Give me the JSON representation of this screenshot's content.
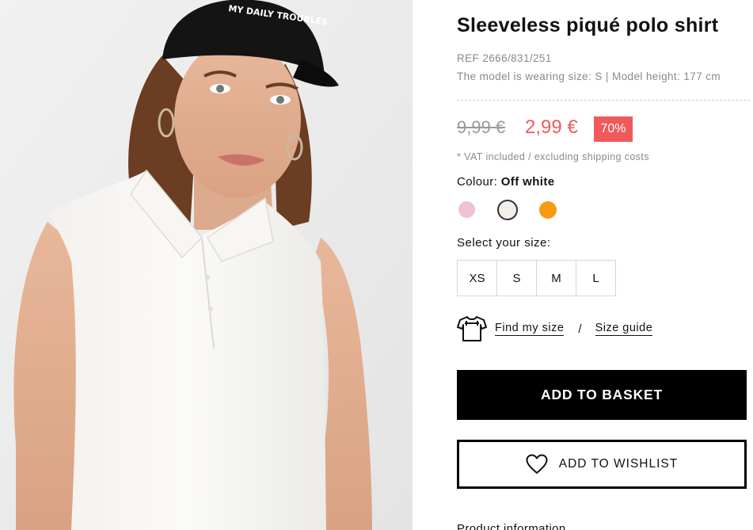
{
  "product": {
    "title": "Sleeveless piqué polo shirt",
    "ref": "REF 2666/831/251",
    "model_info": "The model is wearing size: S | Model height: 177 cm",
    "old_price": "9,99 €",
    "new_price": "2,99 €",
    "discount": "70%",
    "vat_note": "* VAT included / excluding shipping costs",
    "cap_text": "MY DAILY TROUBLES"
  },
  "colour": {
    "label": "Colour:",
    "selected": "Off white",
    "swatches": [
      {
        "name": "pink",
        "hex": "#eec4cf"
      },
      {
        "name": "off-white",
        "hex": "#f2eeea"
      },
      {
        "name": "orange",
        "hex": "#f59b16"
      }
    ]
  },
  "size": {
    "label": "Select your size:",
    "options": [
      "XS",
      "S",
      "M",
      "L"
    ]
  },
  "fit": {
    "find_my_size": "Find my size",
    "separator": "/",
    "size_guide": "Size guide"
  },
  "actions": {
    "add_to_basket": "ADD TO BASKET",
    "add_to_wishlist": "ADD TO WISHLIST"
  },
  "product_information": "Product information",
  "colors": {
    "sale_red": "#ef5a5a",
    "primary_black": "#000000",
    "muted_grey": "#8a8a8a"
  }
}
